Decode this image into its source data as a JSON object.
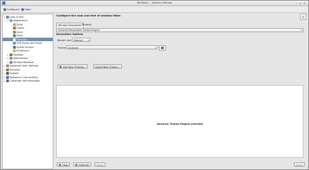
{
  "window": {
    "title": "Windows — System Settings"
  },
  "toolbar": {
    "configure": "Configure",
    "help": "Help"
  },
  "sidebar": {
    "items": [
      {
        "label": "Look & Feel",
        "level": 0,
        "expanded": true,
        "color": "#5b86c5"
      },
      {
        "label": "Appearance",
        "level": 1,
        "expanded": true,
        "color": "#7c9fd4"
      },
      {
        "label": "Style",
        "level": 2,
        "color": "#c9a35a"
      },
      {
        "label": "Colors",
        "level": 2,
        "color": "#d0574f"
      },
      {
        "label": "Icons",
        "level": 2,
        "color": "#5b9e54"
      },
      {
        "label": "Fonts",
        "level": 2,
        "color": "#777777"
      },
      {
        "label": "Windows",
        "level": 2,
        "selected": true,
        "color": "#f2f2f2"
      },
      {
        "label": "GTK Styles and Fonts",
        "level": 2,
        "color": "#6a8fc3"
      },
      {
        "label": "Splash Screen",
        "level": 2,
        "color": "#4a6ea8"
      },
      {
        "label": "Emoticons",
        "level": 2,
        "color": "#e3b63a"
      },
      {
        "label": "Desktop",
        "level": 1,
        "expanded": false,
        "color": "#4d7bbf"
      },
      {
        "label": "Notifications",
        "level": 1,
        "expanded": false,
        "color": "#c98b2c"
      },
      {
        "label": "Window Behavior",
        "level": 1,
        "expanded": false,
        "color": "#6c8dbf"
      },
      {
        "label": "Advanced User Settings",
        "level": 0,
        "expanded": false,
        "color": "#8b8b8b"
      },
      {
        "label": "Personal",
        "level": 0,
        "expanded": false,
        "color": "#c06a3a"
      },
      {
        "label": "System",
        "level": 0,
        "expanded": false,
        "color": "#5a5a5a"
      },
      {
        "label": "Network & Connectivity",
        "level": 0,
        "expanded": false,
        "color": "#3b74b8"
      },
      {
        "label": "Computer Administration",
        "level": 0,
        "expanded": false,
        "color": "#6f6f6f"
      }
    ]
  },
  "content": {
    "header": "Configure the look and feel of window titles",
    "tabs": [
      {
        "label": "Window Decoration",
        "active": true
      },
      {
        "label": "Buttons",
        "active": false
      }
    ],
    "engine_selected": "Aurorae Decoration Theme Engine",
    "decoration_options_label": "Decoration Options",
    "border_size_label": "Border size:",
    "border_size_value": "Normal",
    "theme_label": "Theme:",
    "theme_value": "Aurorae",
    "get_themes_button": "Get New Themes...",
    "install_theme_button": "Install New Theme...",
    "preview_text": "Aurorae Theme Engine preview"
  },
  "bottom": {
    "help": "Help",
    "defaults": "Defaults",
    "reset": "Reset",
    "apply": "Apply"
  },
  "colors": {
    "selection": "#6e8fb3",
    "info_icon": "#2d5fb1"
  }
}
